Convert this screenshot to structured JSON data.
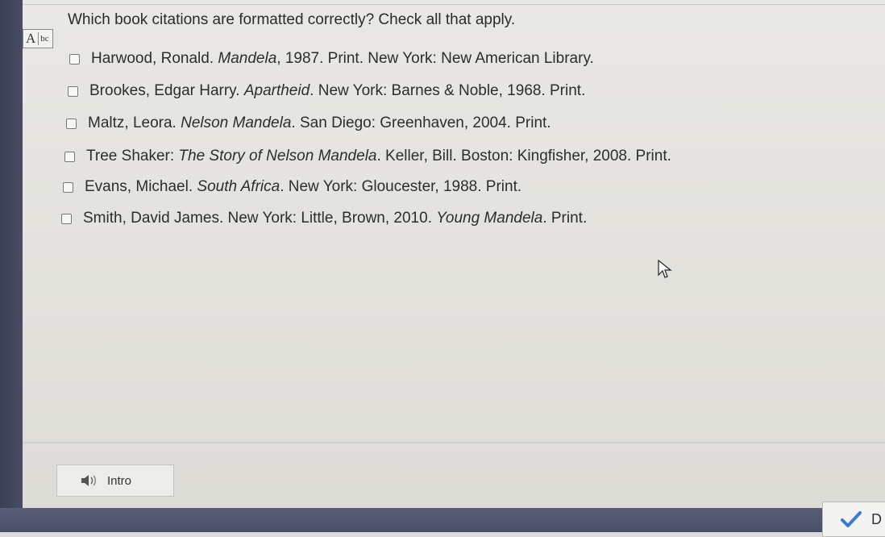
{
  "question": "Which book citations are formatted correctly? Check all that apply.",
  "tool": {
    "big": "A",
    "small": "bc"
  },
  "options": [
    {
      "pre": "Harwood, Ronald. ",
      "italic": "Mandela",
      "post": ", 1987. Print. New York: New American Library."
    },
    {
      "pre": "Brookes, Edgar Harry. ",
      "italic": "Apartheid",
      "post": ". New York: Barnes & Noble, 1968. Print."
    },
    {
      "pre": "Maltz, Leora. ",
      "italic": "Nelson Mandela",
      "post": ". San Diego: Greenhaven, 2004. Print."
    },
    {
      "pre": "Tree Shaker: ",
      "italic": "The Story of Nelson Mandela",
      "post": ". Keller, Bill. Boston: Kingfisher, 2008. Print."
    },
    {
      "pre": "Evans, Michael. ",
      "italic": "South Africa",
      "post": ". New York: Gloucester, 1988. Print."
    },
    {
      "pre": "Smith, David James. New York: Little, Brown, 2010. ",
      "italic": "Young Mandela",
      "post": ". Print."
    }
  ],
  "intro_button": {
    "label": "Intro",
    "icon": "speaker-icon"
  },
  "done_button": {
    "label": "D",
    "icon": "checkmark-icon",
    "check_color": "#3a7bd5"
  }
}
